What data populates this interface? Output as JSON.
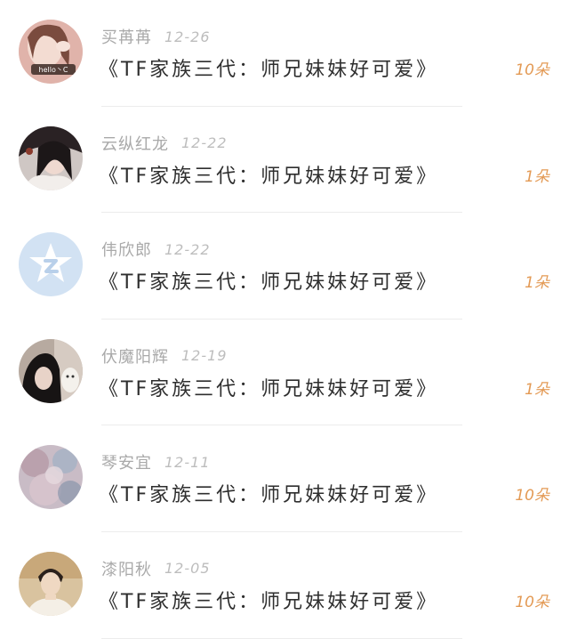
{
  "gifts": [
    {
      "name": "买苒苒",
      "date": "12-26",
      "title": "《TF家族三代：师兄妹妹好可爱》",
      "count": "10朵",
      "avatar_badge": "hello丶C"
    },
    {
      "name": "云纵红龙",
      "date": "12-22",
      "title": "《TF家族三代：师兄妹妹好可爱》",
      "count": "1朵"
    },
    {
      "name": "伟欣郎",
      "date": "12-22",
      "title": "《TF家族三代：师兄妹妹好可爱》",
      "count": "1朵"
    },
    {
      "name": "伏魔阳辉",
      "date": "12-19",
      "title": "《TF家族三代：师兄妹妹好可爱》",
      "count": "1朵"
    },
    {
      "name": "琴安宜",
      "date": "12-11",
      "title": "《TF家族三代：师兄妹妹好可爱》",
      "count": "10朵"
    },
    {
      "name": "漆阳秋",
      "date": "12-05",
      "title": "《TF家族三代：师兄妹妹好可爱》",
      "count": "10朵"
    }
  ],
  "colors": {
    "count_accent": "#e39a55",
    "name_gray": "#a9a9a9",
    "title_dark": "#2e2e2e",
    "default_avatar": "#c9dcf0"
  }
}
